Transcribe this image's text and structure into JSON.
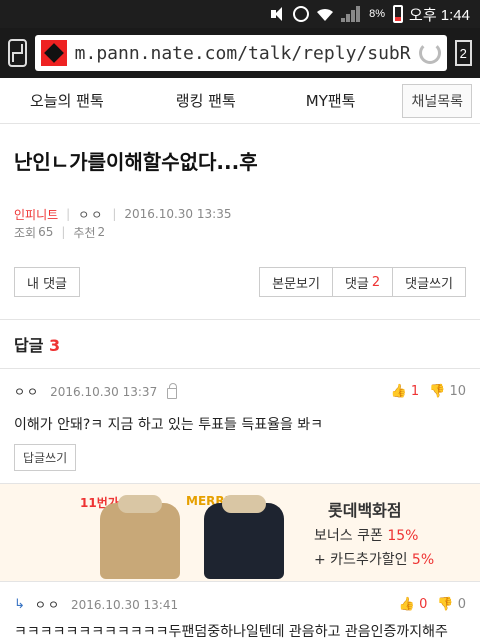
{
  "status_bar": {
    "battery": "8%",
    "time": "오후 1:44"
  },
  "browser": {
    "url": "m.pann.nate.com/talk/reply/subR",
    "tab_count": "2"
  },
  "nav": {
    "items": [
      "오늘의 팬톡",
      "랭킹 팬톡",
      "MY팬톡"
    ],
    "channel_button": "채널목록"
  },
  "post": {
    "title": "난인ㄴ가를이해할수없다...후",
    "author": "인피니트",
    "user": "ㅇㅇ",
    "datetime": "2016.10.30 13:35",
    "views_label": "조회",
    "views": "65",
    "recommend_label": "추천",
    "recommend": "2"
  },
  "actions": {
    "my_comments": "내 댓글",
    "view_post": "본문보기",
    "comments_label": "댓글",
    "comments_count": "2",
    "write_comment": "댓글쓰기"
  },
  "replies": {
    "label": "답글",
    "count": "3"
  },
  "comment": {
    "user": "ㅇㅇ",
    "datetime": "2016.10.30 13:37",
    "up": "1",
    "down": "10",
    "body": "이해가 안돼?ㅋ 지금 하고 있는 투표들 득표율을 봐ㅋ",
    "reply_button": "답글쓰기"
  },
  "ad": {
    "tag": "11번가",
    "brand": "MERRELL",
    "store": "롯데백화점",
    "line1_text": "보너스 쿠폰",
    "line1_value": "15%",
    "line2_text": "+ 카드추가할인",
    "line2_value": "5%"
  },
  "sub_comment": {
    "arrow": "↳",
    "user": "ㅇㅇ",
    "datetime": "2016.10.30 13:41",
    "up": "0",
    "down": "0",
    "body": "ㅋㅋㅋㅋㅋㅋㅋㅋㅋㅋㅋㅋ두팬덤중하나일텐데 관음하고 관음인증까지해주네?갸ㅂㅁㄱ"
  }
}
